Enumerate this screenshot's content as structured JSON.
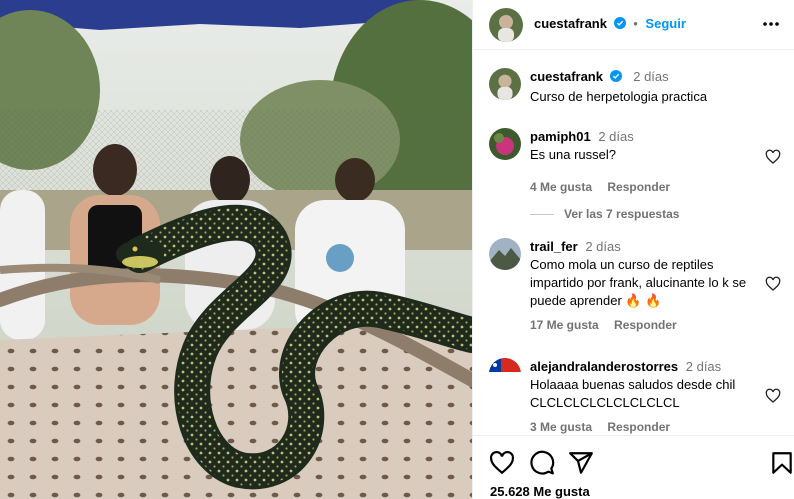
{
  "post": {
    "author": "cuestafrank",
    "follow_label": "Seguir",
    "separator": "•",
    "caption_time": "2 días",
    "caption": "Curso de herpetologia practica",
    "likes": "25.628 Me gusta"
  },
  "comments": [
    {
      "user": "pamiph01",
      "time": "2 días",
      "text": "Es una russel?",
      "likes": "4 Me gusta",
      "reply": "Responder"
    },
    {
      "user": "trail_fer",
      "time": "2 días",
      "text": "Como mola un curso de reptiles impartido por frank, alucinante lo k se puede aprender 🔥 🔥",
      "likes": "17 Me gusta",
      "reply": "Responder"
    },
    {
      "user": "alejandralanderostorres",
      "time": "2 días",
      "text": "Holaaaa buenas saludos desde chil",
      "text2": "CLCLCLCLCLCLCLCLCL",
      "likes": "3 Me gusta",
      "reply": "Responder"
    }
  ],
  "view_replies": "Ver las 7 respuestas",
  "colors": {
    "link": "#0095f6",
    "verified": "#0095f6",
    "muted": "#737373"
  },
  "icons": [
    "verified-badge-icon",
    "more-options-icon",
    "heart-icon",
    "comment-icon",
    "share-icon",
    "bookmark-icon"
  ]
}
